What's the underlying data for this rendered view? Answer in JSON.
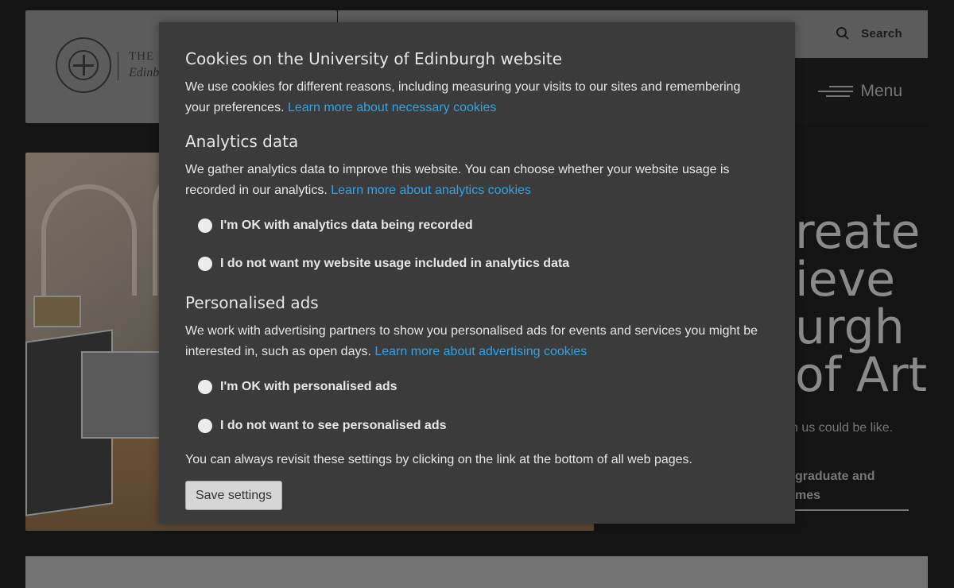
{
  "header": {
    "logo_line1": "THE U",
    "logo_line2": "Edinb",
    "search_label": "Search",
    "menu_label": "Menu"
  },
  "hero": {
    "heading": "reate\nieve\nurgh\nof Art",
    "subtext": "n us could be like.",
    "link": "graduate and\nmes"
  },
  "cookie_modal": {
    "title": "Cookies on the University of Edinburgh website",
    "intro_text": "We use cookies for different reasons, including measuring your visits to our sites and remembering your preferences.",
    "intro_link": "Learn more about necessary cookies",
    "analytics": {
      "heading": "Analytics data",
      "text": "We gather analytics data to improve this website. You can choose whether your website usage is recorded in our analytics.",
      "link": "Learn more about analytics cookies",
      "option_yes": "I'm OK with analytics data being recorded",
      "option_no": "I do not want my website usage included in analytics data"
    },
    "ads": {
      "heading": "Personalised ads",
      "text": "We work with advertising partners to show you personalised ads for events and services you might be interested in, such as open days.",
      "link": "Learn more about advertising cookies",
      "option_yes": "I'm OK with personalised ads",
      "option_no": "I do not want to see personalised ads"
    },
    "footer_text": "You can always revisit these settings by clicking on the link at the bottom of all web pages.",
    "save_label": "Save settings"
  },
  "colors": {
    "modal_bg": "#3b3b3b",
    "link": "#2ea3e6",
    "page_bg": "#141414"
  }
}
